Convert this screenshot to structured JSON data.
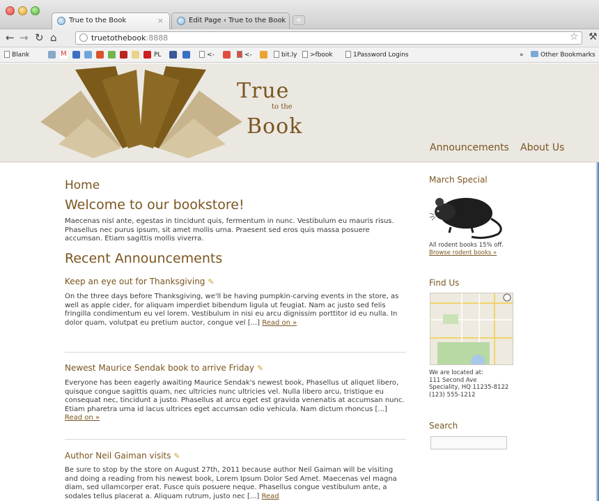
{
  "browser": {
    "tabs": [
      {
        "label": "True to the Book",
        "active": true
      },
      {
        "label": "Edit Page ‹ True to the Book",
        "active": false
      }
    ],
    "tab_close": "×",
    "new_tab": "+",
    "url_host": "truetothebook",
    "url_port": ":8888",
    "bookmarks": [
      {
        "label": "Blank"
      },
      {
        "label": "PL"
      },
      {
        "label": "<-"
      },
      {
        "label": "<-"
      },
      {
        "label": "bit.ly"
      },
      {
        "label": ">fbook"
      },
      {
        "label": "1Password Logins"
      },
      {
        "label": "»"
      },
      {
        "label": "Other Bookmarks"
      }
    ]
  },
  "site": {
    "logo": {
      "line1": "True",
      "line2": "to the",
      "line3": "Book"
    },
    "nav": [
      "Announcements",
      "About Us"
    ],
    "page_title": "Home",
    "welcome_heading": "Welcome to our bookstore!",
    "welcome_text": "Maecenas nisl ante, egestas in tincidunt quis, fermentum in nunc. Vestibulum eu mauris risus. Phasellus nec purus ipsum, sit amet mollis urna. Praesent sed eros quis massa posuere accumsan. Etiam sagittis mollis viverra.",
    "recent_heading": "Recent Announcements",
    "posts": [
      {
        "title": "Keep an eye out for Thanksgiving",
        "body": "On the three days before Thanksgiving, we'll be having pumpkin-carving events in the store, as well as apple cider, for aliquam imperdiet bibendum ligula ut feugiat. Nam ac justo sed felis fringilla condimentum eu vel lorem. Vestibulum in nisi eu arcu dignissim porttitor id eu nulla. In dolor quam, volutpat eu pretium auctor, congue vel [...]",
        "read_on": "Read on »"
      },
      {
        "title": "Newest Maurice Sendak book to arrive Friday",
        "body": "Everyone has been eagerly awaiting Maurice Sendak's newest book, Phasellus ut aliquet libero, quisque congue sagittis quam, nec ultricies nunc ultricies vel. Nulla libero arcu, tristique eu consequat nec, tincidunt a justo. Phasellus at arcu eget est gravida venenatis at accumsan nunc. Etiam pharetra urna id lacus ultrices eget accumsan odio vehicula. Nam dictum rhoncus [...]",
        "read_on": "Read on »"
      },
      {
        "title": "Author Neil Gaiman visits",
        "body": "Be sure to stop by the store on August 27th, 2011 because author Neil Gaiman will be visiting and doing a reading from his newest book, Lorem Ipsum Dolor Sed Amet. Maecenas vel magna diam, sed ullamcorper erat. Fusce quis posuere neque. Phasellus congue vestibulum ante, a sodales tellus placerat a. Aliquam rutrum, justo nec [...]",
        "read_on": "Read"
      }
    ],
    "sidebar": {
      "special_heading": "March Special",
      "special_text": "All rodent books 15% off.",
      "special_link": "Browse rodent books »",
      "find_heading": "Find Us",
      "address_lines": [
        "We are located at:",
        "111 Second Ave",
        "Speciality, HQ 11235-8122",
        "(123) 555-1212"
      ],
      "search_heading": "Search"
    }
  },
  "colors": {
    "brand": "#7a5520",
    "header_bg": "#ebe8e2",
    "book_dark": "#7b5a1a",
    "book_light": "#c7b48c"
  }
}
